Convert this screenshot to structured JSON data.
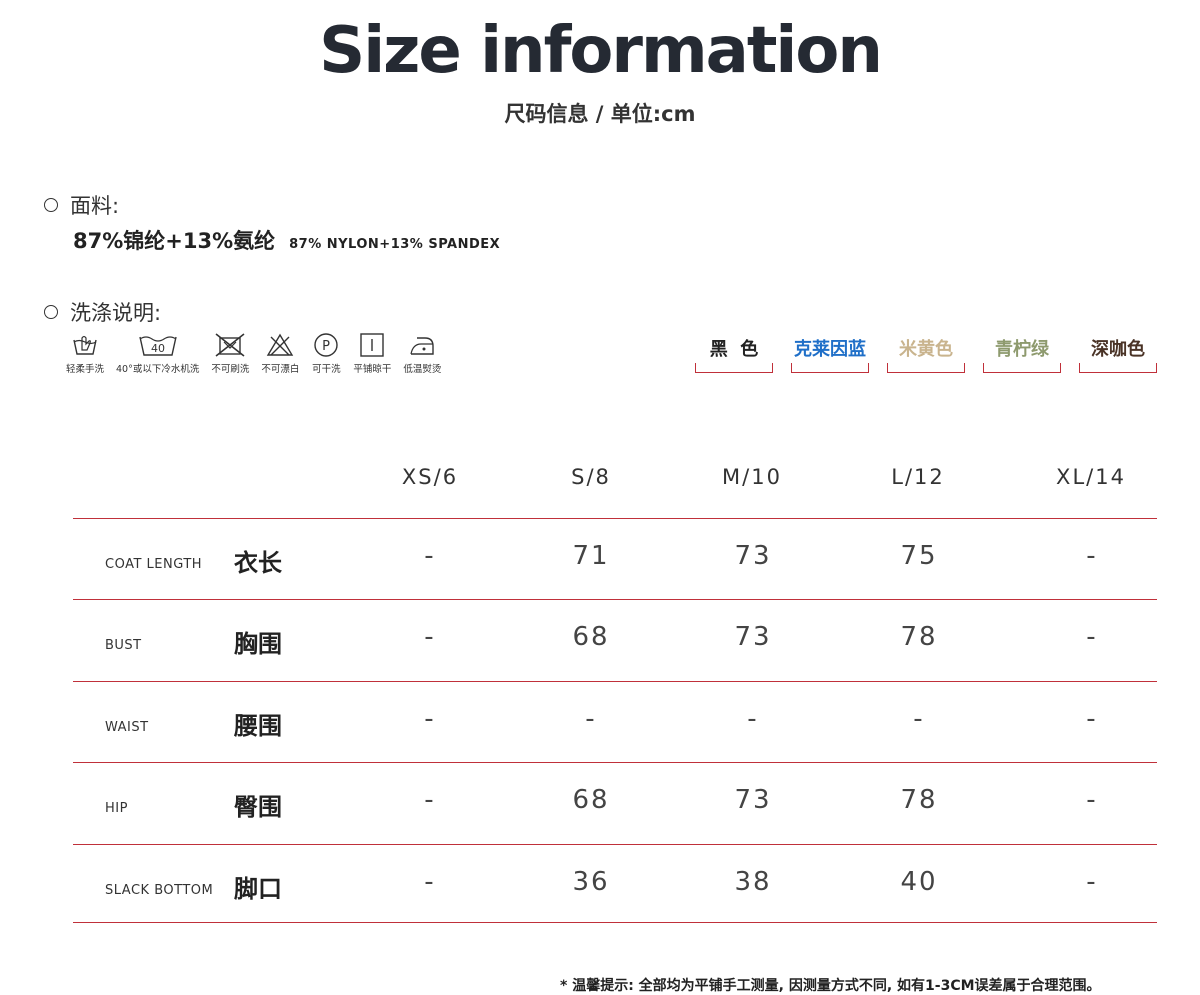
{
  "title": "Size information",
  "subtitle": "尺码信息 / 单位:cm",
  "fabric": {
    "label": "面料:",
    "value_cn": "87%锦纶+13%氨纶",
    "value_en": "87% NYLON+13% SPANDEX"
  },
  "wash": {
    "label": "洗涤说明:",
    "icons": [
      {
        "icon": "hand-wash-icon",
        "label": "轻柔手洗"
      },
      {
        "icon": "machine-wash-40-icon",
        "label": "40°或以下冷水机洗",
        "mark": "40"
      },
      {
        "icon": "no-brush-icon",
        "label": "不可刷洗"
      },
      {
        "icon": "no-bleach-icon",
        "label": "不可漂白"
      },
      {
        "icon": "dry-clean-icon",
        "label": "可干洗",
        "mark": "P"
      },
      {
        "icon": "flat-dry-icon",
        "label": "平铺晾干"
      },
      {
        "icon": "low-iron-icon",
        "label": "低温熨烫"
      }
    ]
  },
  "colors": [
    {
      "name": "黑  色",
      "color": "#222222"
    },
    {
      "name": "克莱因蓝",
      "color": "#1f6fc8"
    },
    {
      "name": "米黄色",
      "color": "#c9b48e"
    },
    {
      "name": "青柠绿",
      "color": "#8e9a6e"
    },
    {
      "name": "深咖色",
      "color": "#4a3326"
    }
  ],
  "table": {
    "sizes": [
      "XS/6",
      "S/8",
      "M/10",
      "L/12",
      "XL/14"
    ],
    "rows": [
      {
        "en": "COAT LENGTH",
        "cn": "衣长",
        "values": [
          "-",
          "71",
          "73",
          "75",
          "-"
        ]
      },
      {
        "en": "BUST",
        "cn": "胸围",
        "values": [
          "-",
          "68",
          "73",
          "78",
          "-"
        ]
      },
      {
        "en": "WAIST",
        "cn": "腰围",
        "values": [
          "-",
          "-",
          "-",
          "-",
          "-"
        ]
      },
      {
        "en": "HIP",
        "cn": "臀围",
        "values": [
          "-",
          "68",
          "73",
          "78",
          "-"
        ]
      },
      {
        "en": "SLACK BOTTOM",
        "cn": "脚口",
        "values": [
          "-",
          "36",
          "38",
          "40",
          "-"
        ]
      }
    ]
  },
  "footnote": "* 温馨提示: 全部均为平铺手工测量, 因测量方式不同, 如有1-3CM误差属于合理范围。"
}
